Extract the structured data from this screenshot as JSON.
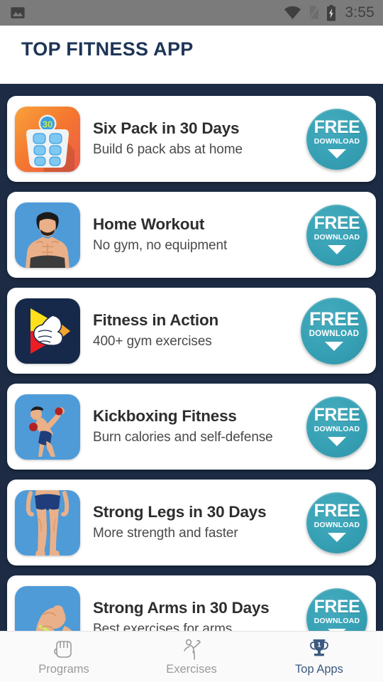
{
  "status_bar": {
    "time": "3:55",
    "icons": [
      "image-icon",
      "wifi-icon",
      "sim-card-off-icon",
      "battery-charging-icon"
    ]
  },
  "header": {
    "title": "TOP FITNESS APP"
  },
  "colors": {
    "background": "#1d2c44",
    "card": "#ffffff",
    "title_text": "#1d3557",
    "badge_teal": "#36a0b4",
    "nav_active": "#3c5a80",
    "nav_inactive": "#9a9a9a",
    "status_bar": "#7b7b7b"
  },
  "badge": {
    "free_label": "FREE",
    "download_label": "DOWNLOAD"
  },
  "apps": [
    {
      "title": "Six Pack in 30 Days",
      "subtitle": "Build 6 pack abs at home",
      "icon": "six-pack-abs-icon",
      "badge_size": "normal"
    },
    {
      "title": "Home Workout",
      "subtitle": "No gym, no equipment",
      "icon": "muscular-man-icon",
      "badge_size": "normal"
    },
    {
      "title": "Fitness in Action",
      "subtitle": "400+ gym exercises",
      "icon": "play-button-biceps-icon",
      "badge_size": "big"
    },
    {
      "title": "Kickboxing Fitness",
      "subtitle": "Burn calories and self-defense",
      "icon": "kickboxer-icon",
      "badge_size": "normal"
    },
    {
      "title": "Strong Legs in 30 Days",
      "subtitle": "More strength and faster",
      "icon": "legs-icon",
      "badge_size": "normal"
    },
    {
      "title": "Strong Arms in 30 Days",
      "subtitle": "Best exercises for arms",
      "icon": "flexed-bicep-icon",
      "badge_size": "normal"
    }
  ],
  "bottom_nav": {
    "items": [
      {
        "label": "Programs",
        "icon": "fist-icon",
        "active": false
      },
      {
        "label": "Exercises",
        "icon": "kicking-figure-icon",
        "active": false
      },
      {
        "label": "Top Apps",
        "icon": "trophy-one-icon",
        "active": true
      }
    ]
  }
}
